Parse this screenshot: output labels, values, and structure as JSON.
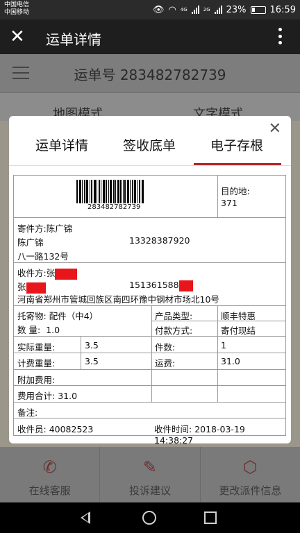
{
  "status_bar": {
    "carrier_1": "中国电信",
    "carrier_2": "中国移动",
    "net_1": "4G",
    "net_2": "2G",
    "battery": "23%",
    "time": "16:59"
  },
  "app_bar": {
    "title": "运单详情"
  },
  "background": {
    "waybill_label": "运单号 283482782739",
    "tabs": [
      "地图模式",
      "文字模式"
    ],
    "bottom_actions": [
      {
        "label": "在线客服",
        "icon": "phone-icon"
      },
      {
        "label": "投诉建议",
        "icon": "edit-icon"
      },
      {
        "label": "更改派件信息",
        "icon": "box-icon"
      }
    ]
  },
  "modal": {
    "tabs": [
      "运单详情",
      "签收底单",
      "电子存根"
    ],
    "active_tab": "电子存根",
    "accent_color": "#b5232b",
    "stub": {
      "barcode_number": "283482782739",
      "destination_label": "目的地:",
      "destination_code": "371",
      "sender_label": "寄件方:",
      "sender_name": "陈广锦",
      "sender_name_2": "陈广锦",
      "sender_phone": "13328387920",
      "sender_address": "八一路132号",
      "recipient_label": "收件方:",
      "recipient_name": "张",
      "recipient_name_2": "张",
      "recipient_phone": "151361588",
      "recipient_address": "河南省郑州市管城回族区南四环豫中钢材市场北10号",
      "cargo_label": "托寄物:",
      "cargo_value": "配件（中4）",
      "product_type_label": "产品类型:",
      "product_type_value": "顺丰特惠",
      "quantity_label": "数 量:",
      "quantity_value": "1.0",
      "payment_label": "付款方式:",
      "payment_value": "寄付现结",
      "actual_weight_label": "实际重量:",
      "actual_weight_value": "3.5",
      "pieces_label": "件数:",
      "pieces_value": "1",
      "billed_weight_label": "计费重量:",
      "billed_weight_value": "3.5",
      "freight_label": "运费:",
      "freight_value": "31.0",
      "extra_fee_label": "附加费用:",
      "total_fee_label": "费用合计:",
      "total_fee_value": "31.0",
      "remarks_label": "备注:",
      "courier_label": "收件员:",
      "courier_value": "40082523",
      "pickup_time_label": "收件时间:",
      "pickup_time_value": "2018-03-19 14:38:27"
    }
  }
}
